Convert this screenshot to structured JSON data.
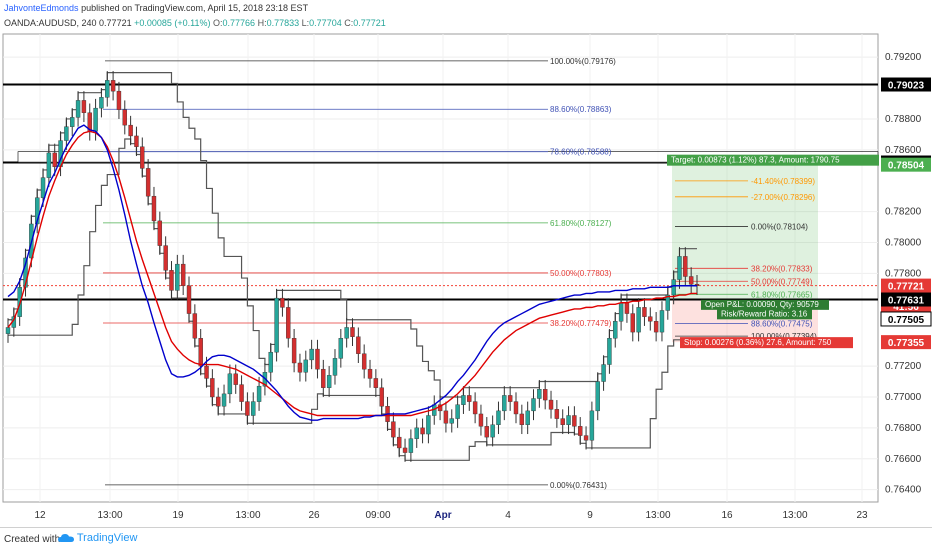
{
  "header": {
    "author": "JahvonteEdmonds",
    "published": "published on TradingView.com, April 15, 2018 23:18 EST",
    "symbol": "OANDA:AUDUSD, 240",
    "last": "0.77721",
    "change": "+0.00085 (+0.11%)",
    "o_label": "O:",
    "o": "0.77766",
    "h_label": "H:",
    "h": "0.77833",
    "l_label": "L:",
    "l": "0.77704",
    "c_label": "C:",
    "c": "0.77721"
  },
  "footer": {
    "created": "Created with",
    "brand": "TradingView"
  },
  "colors": {
    "price_line": "#333333",
    "ema_fast": "#0000cc",
    "ema_slow": "#e00000",
    "channel": "#555555",
    "up": "#26a69a",
    "down": "#d32f2f",
    "target": "#4caf50",
    "stop": "#f44336"
  },
  "chart_data": {
    "type": "candlestick",
    "y_ticks": [
      "0.79200",
      "0.78800",
      "0.78600",
      "0.78200",
      "0.78000",
      "0.77800",
      "0.77200",
      "0.77000",
      "0.76800",
      "0.76600",
      "0.76400"
    ],
    "y_tick_values": [
      0.792,
      0.788,
      0.786,
      0.782,
      0.78,
      0.778,
      0.772,
      0.77,
      0.768,
      0.766,
      0.764
    ],
    "x_ticks": [
      "12",
      "13:00",
      "19",
      "13:00",
      "26",
      "09:00",
      "Apr",
      "4",
      "9",
      "13:00",
      "16",
      "13:00",
      "23"
    ],
    "ylim": [
      0.7632,
      0.7935
    ],
    "price_labels": [
      {
        "text": "0.79023",
        "value": 0.79023,
        "style": "black"
      },
      {
        "text": "0.78518",
        "value": 0.78518,
        "style": "black"
      },
      {
        "text": "0.78504",
        "value": 0.78504,
        "style": "green"
      },
      {
        "text": "0.77721",
        "value": 0.77721,
        "style": "red"
      },
      {
        "text": "41:56",
        "value": 0.7759,
        "style": "red"
      },
      {
        "text": "0.77631",
        "value": 0.77631,
        "style": "black"
      },
      {
        "text": "0.77505",
        "value": 0.77505,
        "style": "white"
      },
      {
        "text": "0.77355",
        "value": 0.77355,
        "style": "red"
      }
    ],
    "horizontal_levels": [
      {
        "value": 0.79023,
        "style": "black"
      },
      {
        "value": 0.78518,
        "style": "black"
      },
      {
        "value": 0.77631,
        "style": "black"
      },
      {
        "value": 0.77721,
        "style": "red-dotted"
      }
    ],
    "fib_left": [
      {
        "text": "100.00%(0.79176)",
        "value": 0.79176,
        "color": "#333333"
      },
      {
        "text": "88.60%(0.78863)",
        "value": 0.78863,
        "color": "#3f51b5"
      },
      {
        "text": "78.60%(0.78588)",
        "value": 0.78588,
        "color": "#3f51b5"
      },
      {
        "text": "61.80%(0.78127)",
        "value": 0.78127,
        "color": "#4caf50"
      },
      {
        "text": "50.00%(0.77803)",
        "value": 0.77803,
        "color": "#e53935"
      },
      {
        "text": "38.20%(0.77479)",
        "value": 0.77479,
        "color": "#e53935"
      },
      {
        "text": "0.00%(0.76431)",
        "value": 0.76431,
        "color": "#333333"
      }
    ],
    "fib_right": [
      {
        "text": "-41.40%(0.78399)",
        "value": 0.78399,
        "color": "#ff9800"
      },
      {
        "text": "-27.00%(0.78296)",
        "value": 0.78296,
        "color": "#ff9800"
      },
      {
        "text": "0.00%(0.78104)",
        "value": 0.78104,
        "color": "#333333"
      },
      {
        "text": "38.20%(0.77833)",
        "value": 0.77833,
        "color": "#e53935"
      },
      {
        "text": "50.00%(0.77749)",
        "value": 0.77749,
        "color": "#e53935"
      },
      {
        "text": "61.80%(0.77665)",
        "value": 0.77665,
        "color": "#4caf50"
      },
      {
        "text": "88.60%(0.77475)",
        "value": 0.77475,
        "color": "#3f51b5"
      },
      {
        "text": "100.00%(0.77394)",
        "value": 0.77394,
        "color": "#333333"
      }
    ],
    "position": {
      "entry": 0.77631,
      "target": 0.78504,
      "stop": 0.77355,
      "target_label": "Target: 0.00873 (1.12%) 87.3, Amount: 1790.75",
      "stop_label": "Stop: 0.00276 (0.36%) 27.6, Amount: 750",
      "pnl_label": "Open P&L: 0.00090, Qty: 90579",
      "rr_label": "Risk/Reward Ratio: 3.16"
    },
    "closes": [
      0.7745,
      0.7752,
      0.7771,
      0.779,
      0.7812,
      0.7829,
      0.7842,
      0.7858,
      0.7849,
      0.7866,
      0.7875,
      0.7881,
      0.7892,
      0.7884,
      0.7872,
      0.7887,
      0.7894,
      0.7905,
      0.7898,
      0.7886,
      0.7876,
      0.7869,
      0.7862,
      0.7848,
      0.783,
      0.7814,
      0.7798,
      0.7782,
      0.7769,
      0.7786,
      0.7772,
      0.7754,
      0.7738,
      0.772,
      0.7712,
      0.77,
      0.7694,
      0.7702,
      0.7715,
      0.7708,
      0.7697,
      0.7688,
      0.7697,
      0.7707,
      0.7716,
      0.7729,
      0.7764,
      0.7758,
      0.7738,
      0.7722,
      0.7716,
      0.7724,
      0.7731,
      0.7718,
      0.7706,
      0.7714,
      0.7725,
      0.7738,
      0.7745,
      0.7739,
      0.7728,
      0.7718,
      0.7712,
      0.7706,
      0.7694,
      0.7684,
      0.7674,
      0.7667,
      0.7664,
      0.7673,
      0.768,
      0.7676,
      0.7688,
      0.7695,
      0.7691,
      0.7683,
      0.7686,
      0.7695,
      0.7701,
      0.7697,
      0.7689,
      0.7681,
      0.7674,
      0.7682,
      0.7691,
      0.7701,
      0.7697,
      0.7689,
      0.7682,
      0.7691,
      0.7699,
      0.7705,
      0.7698,
      0.7692,
      0.7686,
      0.7682,
      0.7688,
      0.7681,
      0.7675,
      0.7672,
      0.7691,
      0.771,
      0.7721,
      0.7738,
      0.7749,
      0.7761,
      0.7754,
      0.7742,
      0.7758,
      0.7752,
      0.7749,
      0.7742,
      0.7756,
      0.7766,
      0.7776,
      0.7791,
      0.7778,
      0.7773,
      0.7772
    ],
    "ema_fast": [
      0.7765,
      0.7768,
      0.7775,
      0.7786,
      0.78,
      0.7814,
      0.7826,
      0.7838,
      0.7845,
      0.7854,
      0.7862,
      0.7868,
      0.7874,
      0.7876,
      0.7873,
      0.7872,
      0.7868,
      0.786,
      0.7848,
      0.7834,
      0.7818,
      0.7801,
      0.7786,
      0.7772,
      0.7761,
      0.7748,
      0.7736,
      0.7724,
      0.7715,
      0.7713,
      0.7713,
      0.7714,
      0.7716,
      0.7719,
      0.7723,
      0.7726,
      0.7727,
      0.7727,
      0.7726,
      0.7724,
      0.7722,
      0.772,
      0.7718,
      0.7715,
      0.7712,
      0.7708,
      0.7704,
      0.7699,
      0.7694,
      0.769,
      0.7687,
      0.7686,
      0.7685,
      0.7685,
      0.7686,
      0.7686,
      0.7686,
      0.7686,
      0.7686,
      0.7686,
      0.7686,
      0.7687,
      0.7687,
      0.7688,
      0.7688,
      0.7689,
      0.7689,
      0.7689,
      0.7689,
      0.769,
      0.7691,
      0.7692,
      0.7693,
      0.7695,
      0.7698,
      0.7701,
      0.7705,
      0.771,
      0.7714,
      0.7719,
      0.7724,
      0.773,
      0.7736,
      0.7741,
      0.7745,
      0.7748,
      0.775,
      0.7752,
      0.7754,
      0.7756,
      0.7758,
      0.776,
      0.7761,
      0.7762,
      0.7763,
      0.7764,
      0.7765,
      0.7766,
      0.7766,
      0.7767,
      0.7767,
      0.7768,
      0.7768,
      0.7768,
      0.7769,
      0.7769,
      0.7769,
      0.777,
      0.777,
      0.777,
      0.7771,
      0.7771,
      0.7771,
      0.7771,
      0.7772,
      0.7772,
      0.7772,
      0.7772,
      0.7772
    ],
    "ema_slow": [
      0.7745,
      0.775,
      0.776,
      0.7773,
      0.7788,
      0.7803,
      0.7817,
      0.783,
      0.784,
      0.7849,
      0.7857,
      0.7863,
      0.7868,
      0.7871,
      0.7872,
      0.7871,
      0.7868,
      0.7862,
      0.7853,
      0.7842,
      0.7829,
      0.7815,
      0.7801,
      0.7789,
      0.7778,
      0.7767,
      0.7756,
      0.7745,
      0.7736,
      0.7731,
      0.7727,
      0.7724,
      0.7722,
      0.7721,
      0.7721,
      0.7721,
      0.7721,
      0.772,
      0.7719,
      0.7718,
      0.7716,
      0.7714,
      0.7712,
      0.771,
      0.7708,
      0.7705,
      0.7702,
      0.7699,
      0.7696,
      0.7693,
      0.7691,
      0.769,
      0.7689,
      0.7688,
      0.7688,
      0.7688,
      0.7688,
      0.7688,
      0.7688,
      0.7688,
      0.7688,
      0.7688,
      0.7688,
      0.7688,
      0.7688,
      0.7688,
      0.7688,
      0.7688,
      0.7688,
      0.7688,
      0.7689,
      0.769,
      0.7691,
      0.7692,
      0.7694,
      0.7696,
      0.7699,
      0.7702,
      0.7706,
      0.771,
      0.7714,
      0.7719,
      0.7724,
      0.7729,
      0.7733,
      0.7737,
      0.774,
      0.7743,
      0.7745,
      0.7747,
      0.7749,
      0.7751,
      0.7752,
      0.7753,
      0.7754,
      0.7755,
      0.7756,
      0.7757,
      0.7757,
      0.7758,
      0.7758,
      0.7759,
      0.7759,
      0.776,
      0.776,
      0.7761,
      0.7761,
      0.7762,
      0.7762,
      0.7763,
      0.7763,
      0.7764,
      0.7764,
      0.7765,
      0.7765,
      0.7766,
      0.7766,
      0.7767,
      0.7767
    ]
  }
}
